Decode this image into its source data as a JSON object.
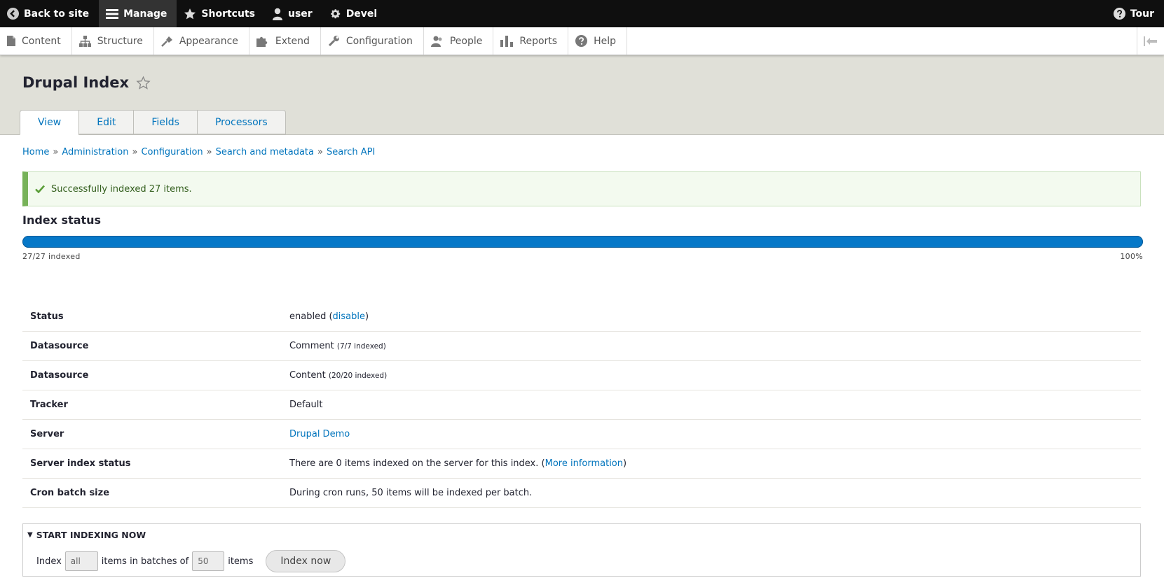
{
  "toolbar": {
    "back_to_site": "Back to site",
    "manage": "Manage",
    "shortcuts": "Shortcuts",
    "user": "user",
    "devel": "Devel",
    "tour": "Tour"
  },
  "tray": {
    "items": [
      {
        "label": "Content",
        "icon": "file-icon"
      },
      {
        "label": "Structure",
        "icon": "sitemap-icon"
      },
      {
        "label": "Appearance",
        "icon": "paintbrush-icon"
      },
      {
        "label": "Extend",
        "icon": "puzzle-icon"
      },
      {
        "label": "Configuration",
        "icon": "wrench-icon"
      },
      {
        "label": "People",
        "icon": "people-icon"
      },
      {
        "label": "Reports",
        "icon": "bar-chart-icon"
      },
      {
        "label": "Help",
        "icon": "question-icon"
      }
    ]
  },
  "header": {
    "title": "Drupal Index",
    "tabs": [
      "View",
      "Edit",
      "Fields",
      "Processors"
    ],
    "active_tab": "View"
  },
  "breadcrumb": [
    "Home",
    "Administration",
    "Configuration",
    "Search and metadata",
    "Search API"
  ],
  "breadcrumb_separator": "»",
  "message": {
    "text": "Successfully indexed 27 items.",
    "color": "#77b259"
  },
  "index_status": {
    "heading": "Index status",
    "progress_fraction": 1.0,
    "left_label": "27/27 indexed",
    "right_label": "100%",
    "bar_color": "#0678c8"
  },
  "details": {
    "status_label": "Status",
    "status_value": "enabled",
    "status_link": "disable",
    "datasource1_label": "Datasource",
    "datasource1_value": "Comment",
    "datasource1_count": "(7/7 indexed)",
    "datasource2_label": "Datasource",
    "datasource2_value": "Content",
    "datasource2_count": "(20/20 indexed)",
    "tracker_label": "Tracker",
    "tracker_value": "Default",
    "server_label": "Server",
    "server_value": "Drupal Demo",
    "server_index_label": "Server index status",
    "server_index_value": "There are 0 items indexed on the server for this index.",
    "server_index_link": "More information",
    "cron_label": "Cron batch size",
    "cron_value": "During cron runs, 50 items will be indexed per batch."
  },
  "indexing": {
    "legend": "START INDEXING NOW",
    "index_label": "Index",
    "items_value": "all",
    "batches_label": "items in batches of",
    "batch_value": "50",
    "items_label": "items",
    "button": "Index now"
  }
}
